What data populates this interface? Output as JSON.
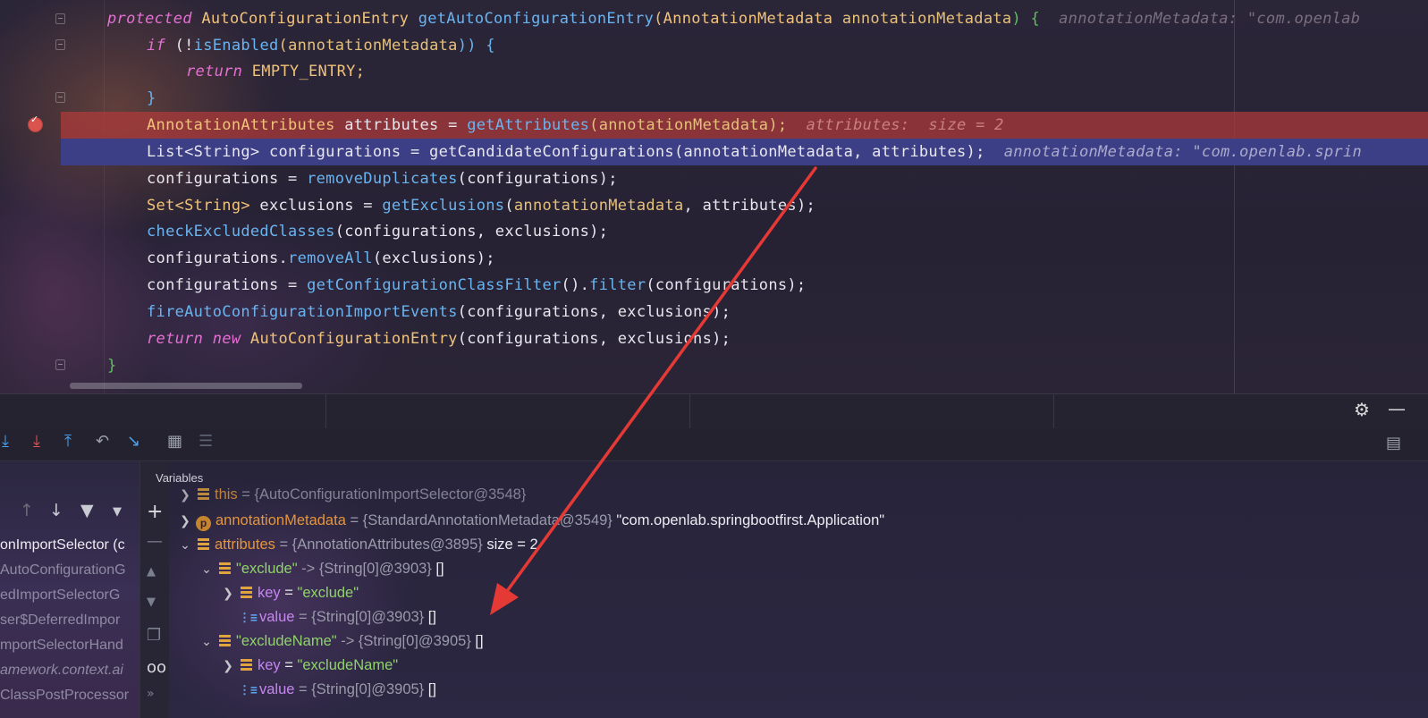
{
  "editor": {
    "lines": [
      {
        "kind": "sig",
        "kw": "protected",
        "ret": "AutoConfigurationEntry",
        "name": "getAutoConfigurationEntry",
        "open": "(",
        "ptype": "AnnotationMetadata",
        "pname": "annotationMetadata",
        "close": ") {",
        "hint": "annotationMetadata: \"com.openlab"
      },
      {
        "kind": "if",
        "kw": "if",
        "text": "(!",
        "call": "isEnabled",
        "arg": "(annotationMetadata",
        ") {": ""
      },
      {
        "kind": "return",
        "kw": "return",
        "value": "EMPTY_ENTRY;"
      },
      {
        "kind": "brace",
        "text": "}"
      },
      {
        "kind": "bp",
        "type": "AnnotationAttributes",
        "rest": " attributes = ",
        "call": "getAttributes",
        "args": "(annotationMetadata);",
        "hint": "attributes:  size = 2"
      },
      {
        "kind": "cur",
        "text": "List<String> configurations = getCandidateConfigurations(annotationMetadata, attributes);",
        "hint": "annotationMetadata: \"com.openlab.sprin"
      },
      {
        "kind": "plain",
        "a": "configurations = ",
        "call": "removeDuplicates",
        "b": "(configurations);"
      },
      {
        "kind": "set",
        "type": "Set<String>",
        "a": " exclusions = ",
        "call": "getExclusions",
        "b": "(",
        "p": "annotationMetadata",
        "c": ", attributes);"
      },
      {
        "kind": "call",
        "call": "checkExcludedClasses",
        "b": "(configurations, exclusions);"
      },
      {
        "kind": "plain",
        "a": "configurations.",
        "call": "removeAll",
        "b": "(exclusions);"
      },
      {
        "kind": "chain",
        "a": "configurations = ",
        "call": "getConfigurationClassFilter",
        "b": "().",
        "call2": "filter",
        "c": "(configurations);"
      },
      {
        "kind": "call",
        "call": "fireAutoConfigurationImportEvents",
        "b": "(configurations, exclusions);"
      },
      {
        "kind": "retnew",
        "kw": "return new",
        "type": "AutoConfigurationEntry",
        "b": "(configurations, exclusions);"
      },
      {
        "kind": "brace",
        "text": "}"
      }
    ]
  },
  "debug": {
    "variables_title": "Variables",
    "frames": [
      {
        "text": "onImportSelector (c",
        "active": true
      },
      {
        "text": "AutoConfigurationG"
      },
      {
        "text": "edImportSelectorG"
      },
      {
        "text": "ser$DeferredImpor"
      },
      {
        "text": "mportSelectorHand"
      },
      {
        "text": "amework.context.ai",
        "italic": true
      },
      {
        "text": "ClassPostProcessor"
      }
    ],
    "variables": [
      {
        "name": "this",
        "rest": " = {AutoConfigurationImportSelector@3548}"
      },
      {
        "name": "annotationMetadata",
        "rest": " = {StandardAnnotationMetadata@3549}",
        "str": " \"com.openlab.springbootfirst.Application\""
      },
      {
        "name": "attributes",
        "rest": " = {AnnotationAttributes@3895}",
        "str": " size = 2"
      },
      {
        "key": "\"exclude\"",
        "rest": " -> {String[0]@3903}",
        "str": " []"
      },
      {
        "name": "key",
        "rest": " = ",
        "val": "\"exclude\""
      },
      {
        "name": "value",
        "rest": " = {String[0]@3903}",
        "str": " []"
      },
      {
        "key": "\"excludeName\"",
        "rest": " -> {String[0]@3905}",
        "str": " []"
      },
      {
        "name": "key",
        "rest": " = ",
        "val": "\"excludeName\""
      },
      {
        "name": "value",
        "rest": " = {String[0]@3905}",
        "str": " []"
      }
    ]
  },
  "icons": {
    "param_letter": "p",
    "array_glyph": "⋮≡"
  },
  "colors": {
    "breakpoint_line": "#b03a3a",
    "current_line": "#3d3f86",
    "annotation_arrow": "#e53935"
  }
}
